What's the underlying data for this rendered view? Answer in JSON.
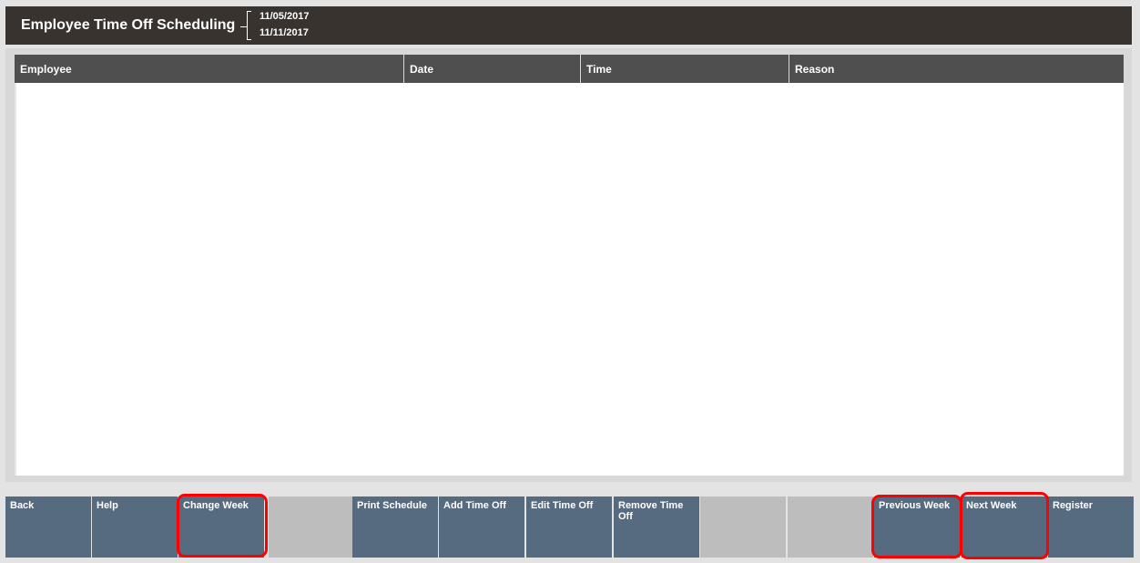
{
  "header": {
    "title": "Employee Time Off Scheduling",
    "start_date": "11/05/2017",
    "end_date": "11/11/2017"
  },
  "table": {
    "columns": [
      "Employee",
      "Date",
      "Time",
      "Reason"
    ],
    "rows": []
  },
  "buttons": [
    {
      "label": "Back"
    },
    {
      "label": "Help"
    },
    {
      "label": "Change Week"
    },
    {
      "label": ""
    },
    {
      "label": "Print Schedule"
    },
    {
      "label": "Add Time Off"
    },
    {
      "label": "Edit Time Off"
    },
    {
      "label": "Remove Time Off"
    },
    {
      "label": ""
    },
    {
      "label": ""
    },
    {
      "label": "Previous Week"
    },
    {
      "label": "Next Week"
    },
    {
      "label": "Register"
    }
  ],
  "colors": {
    "header_bg": "#38332e",
    "table_header_bg": "#4f4f4f",
    "button_bg": "#566a80",
    "button_blank_bg": "#bdbdbd",
    "highlight": "#ff0000"
  }
}
